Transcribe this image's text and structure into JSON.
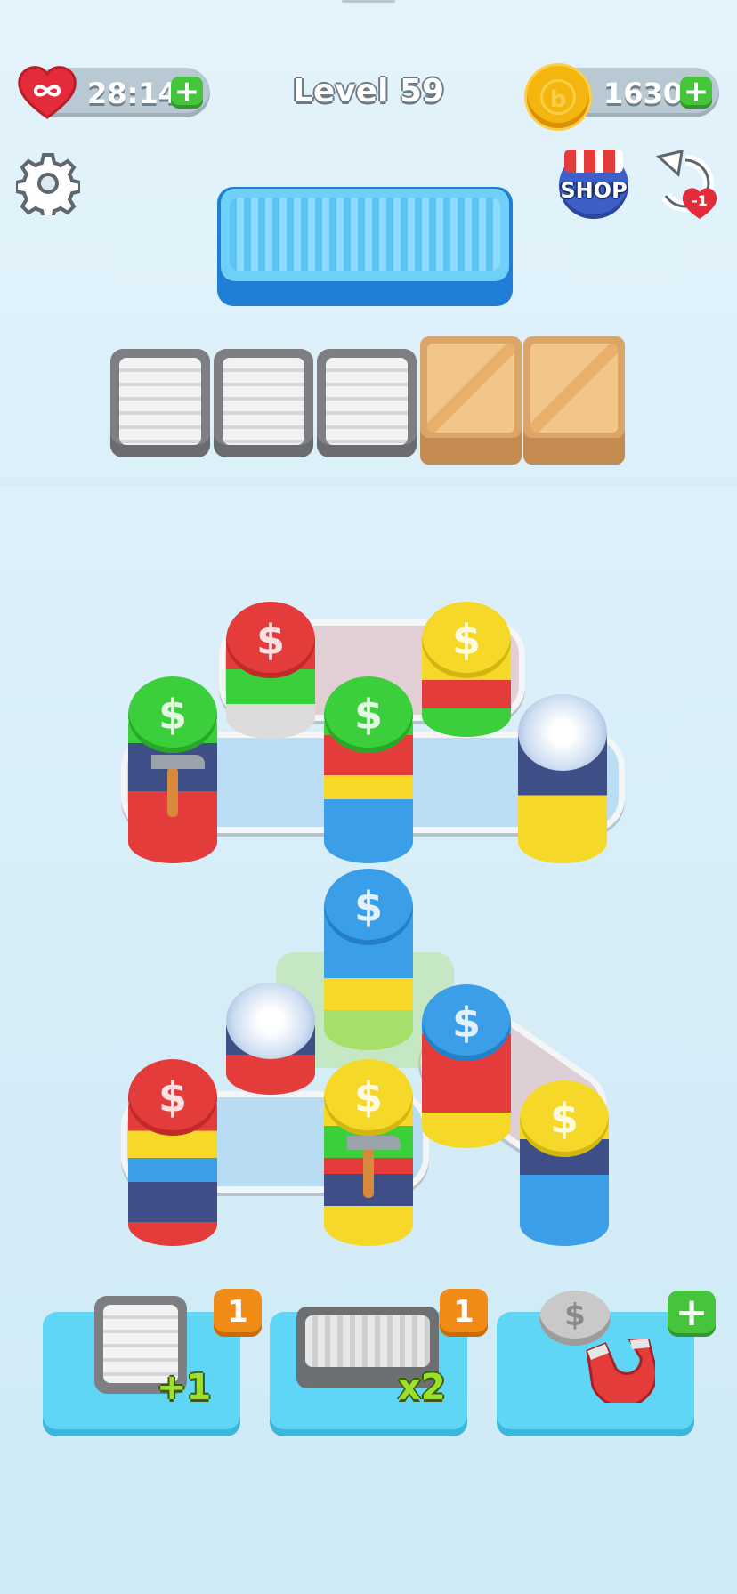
{
  "hud": {
    "lives_timer": "28:14",
    "level_title": "Level 59",
    "coins": "1630",
    "plus_label": "+",
    "shop_label": "SHOP",
    "undo_badge": "-1"
  },
  "holding_slots": {
    "open_slots": 3,
    "locked_crates": 2
  },
  "boosters": [
    {
      "name": "extra-slot",
      "label": "+1",
      "count": "1"
    },
    {
      "name": "double-tray",
      "label": "x2",
      "count": "1"
    },
    {
      "name": "magnet",
      "label": "",
      "count": "+"
    }
  ],
  "colors": {
    "red": "#e43b3b",
    "green": "#3ccf3c",
    "yellow": "#f5d828",
    "blue": "#3a9ee8",
    "navy": "#3d4f86",
    "accent_blue": "#3cb8f0"
  }
}
